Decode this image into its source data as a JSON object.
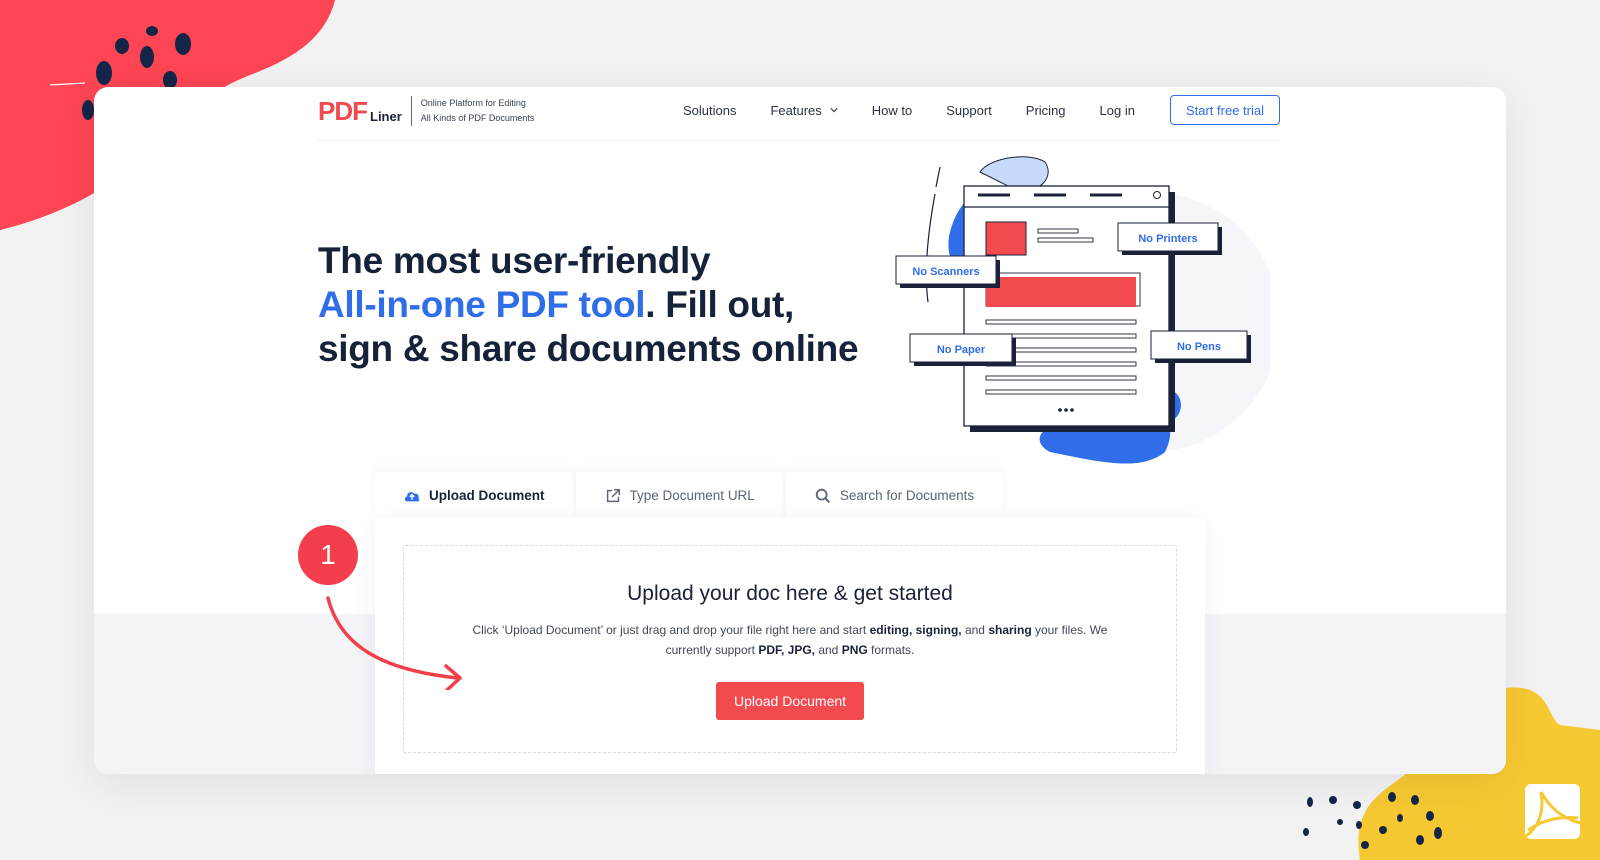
{
  "brand": {
    "logo_pdf": "PDF",
    "logo_liner": "Liner",
    "tagline_line1": "Online Platform for Editing",
    "tagline_line2": "All Kinds of PDF Documents",
    "colors": {
      "red": "#f24a4f",
      "blue": "#2f6ee8",
      "navy": "#16213a",
      "yellow": "#f6c832"
    }
  },
  "nav": {
    "items": [
      {
        "label": "Solutions"
      },
      {
        "label": "Features",
        "has_dropdown": true,
        "icon": "chevron-down-icon"
      },
      {
        "label": "How to"
      },
      {
        "label": "Support"
      },
      {
        "label": "Pricing"
      },
      {
        "label": "Log in"
      }
    ],
    "cta_label": "Start free trial"
  },
  "hero": {
    "line1": "The most user-friendly",
    "accent": "All-in-one PDF tool",
    "line2_rest": ". Fill out,",
    "line3": "sign & share documents online"
  },
  "illustration": {
    "labels": [
      "No Printers",
      "No Scanners",
      "No Paper",
      "No Pens"
    ]
  },
  "tabs": [
    {
      "label": "Upload Document",
      "icon": "cloud-upload-icon",
      "active": true
    },
    {
      "label": "Type Document URL",
      "icon": "external-link-icon",
      "active": false
    },
    {
      "label": "Search for Documents",
      "icon": "search-icon",
      "active": false
    }
  ],
  "upload": {
    "title": "Upload your doc here & get started",
    "desc_part1": "Click ‘Upload Document’ or just drag and drop your file right here and start ",
    "desc_bold1": "editing, signing,",
    "desc_part2": " and ",
    "desc_bold2": "sharing",
    "desc_part3": " your files. We currently support ",
    "desc_bold3": "PDF, JPG,",
    "desc_part4": " and ",
    "desc_bold4": "PNG",
    "desc_part5": " formats.",
    "button_label": "Upload Document"
  },
  "step": {
    "number": "1"
  }
}
